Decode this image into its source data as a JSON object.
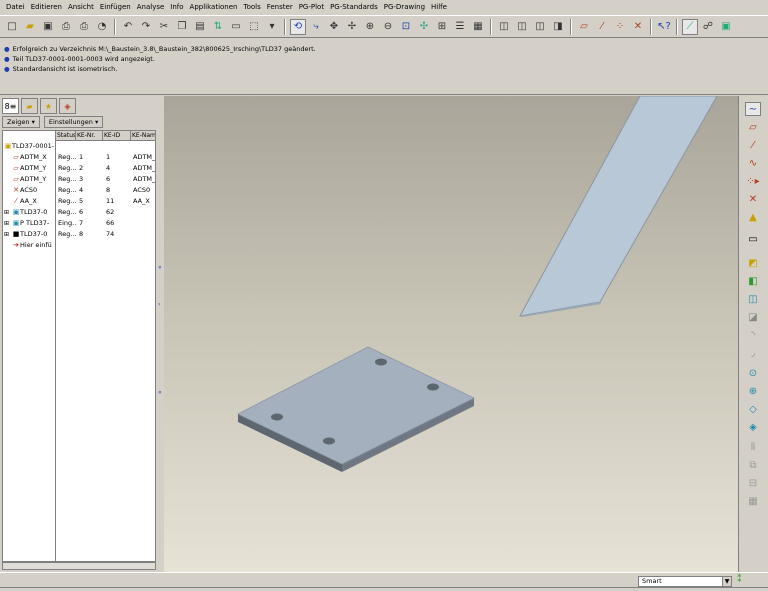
{
  "menu": [
    "Datei",
    "Editieren",
    "Ansicht",
    "Einfügen",
    "Analyse",
    "Info",
    "Applikationen",
    "Tools",
    "Fenster",
    "PG-Plot",
    "PG-Standards",
    "PG-Drawing",
    "Hilfe"
  ],
  "messages": [
    "Erfolgreich zu Verzeichnis M:\\_Baustein_3.8\\_Baustein_382\\800625_Irsching\\TLD37 geändert.",
    "Teil TLD37-0001-0001-0003 wird angezeigt.",
    "Standardansicht ist isometrisch."
  ],
  "panel": {
    "show_label": "Zeigen",
    "settings_label": "Einstellungen",
    "columns": [
      "",
      "Status",
      "KE-Nr.",
      "KE-ID",
      "KE-Nam"
    ],
    "root": "TLD37-0001-",
    "rows": [
      {
        "icon": "datum-plane-icon",
        "name": "ADTM_X",
        "status": "Reg...",
        "nr": "1",
        "id": "1",
        "kname": "ADTM_"
      },
      {
        "icon": "datum-plane-icon",
        "name": "ADTM_Y",
        "status": "Reg...",
        "nr": "2",
        "id": "4",
        "kname": "ADTM_"
      },
      {
        "icon": "datum-plane-icon",
        "name": "ADTM_Y",
        "status": "Reg...",
        "nr": "3",
        "id": "6",
        "kname": "ADTM_"
      },
      {
        "icon": "coordinate-system-icon",
        "name": "ACS0",
        "status": "Reg...",
        "nr": "4",
        "id": "8",
        "kname": "ACS0"
      },
      {
        "icon": "datum-axis-icon",
        "name": "AA_X",
        "status": "Reg...",
        "nr": "5",
        "id": "11",
        "kname": "AA_X"
      },
      {
        "icon": "part-icon",
        "name": "TLD37-0",
        "status": "Reg...",
        "nr": "6",
        "id": "62",
        "kname": ""
      },
      {
        "icon": "part-icon",
        "name": "P TLD37-",
        "status": "Eing...",
        "nr": "7",
        "id": "66",
        "kname": ""
      },
      {
        "icon": "part-black-icon",
        "name": "TLD37-0",
        "status": "Reg...",
        "nr": "8",
        "id": "74",
        "kname": ""
      },
      {
        "icon": "insert-here-icon",
        "name": "Hier einfü",
        "status": "",
        "nr": "",
        "id": "",
        "kname": ""
      }
    ]
  },
  "status": {
    "filter_value": "Smart"
  },
  "colors": {
    "plate_top": "#a4b0bd",
    "plate_side": "#5e6670",
    "beam": "#b9c8d6"
  }
}
